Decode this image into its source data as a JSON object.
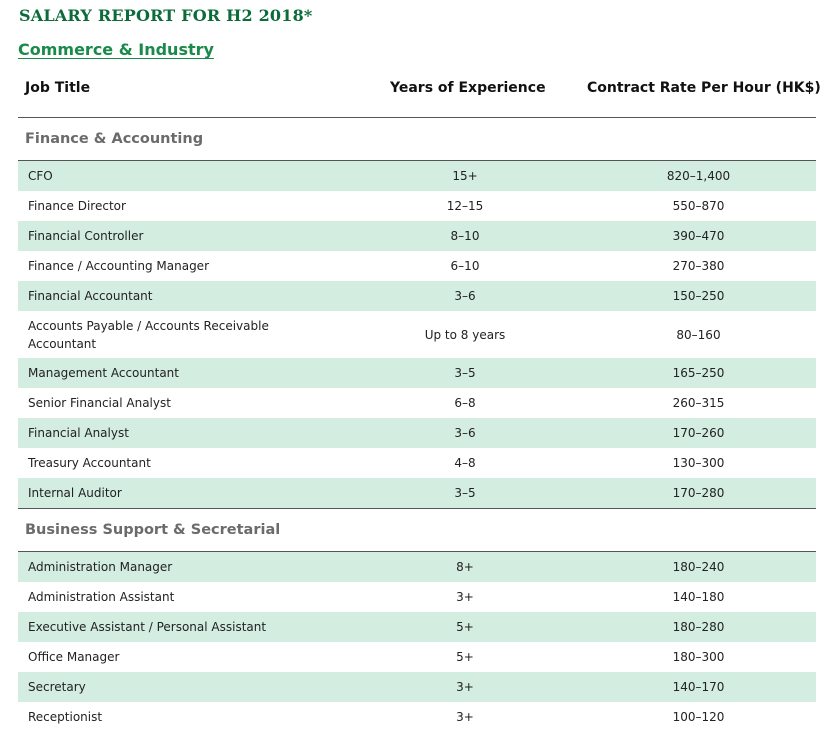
{
  "report": {
    "title": "SALARY REPORT FOR H2 2018*",
    "section": "Commerce & Industry"
  },
  "columns": {
    "job_title": "Job Title",
    "experience": "Years of Experience",
    "rate": "Contract Rate Per Hour (HK$)"
  },
  "groups": [
    {
      "name": "Finance & Accounting",
      "rows": [
        {
          "title": "CFO",
          "experience": "15+",
          "rate": "820–1,400"
        },
        {
          "title": "Finance Director",
          "experience": "12–15",
          "rate": "550–870"
        },
        {
          "title": "Financial Controller",
          "experience": "8–10",
          "rate": "390–470"
        },
        {
          "title": "Finance / Accounting Manager",
          "experience": "6–10",
          "rate": "270–380"
        },
        {
          "title": "Financial Accountant",
          "experience": "3–6",
          "rate": "150–250"
        },
        {
          "title": "Accounts Payable / Accounts Receivable Accountant",
          "experience": "Up to 8 years",
          "rate": "80–160"
        },
        {
          "title": "Management Accountant",
          "experience": "3–5",
          "rate": "165–250"
        },
        {
          "title": "Senior Financial Analyst",
          "experience": "6–8",
          "rate": "260–315"
        },
        {
          "title": "Financial Analyst",
          "experience": "3–6",
          "rate": "170–260"
        },
        {
          "title": "Treasury Accountant",
          "experience": "4–8",
          "rate": "130–300"
        },
        {
          "title": "Internal Auditor",
          "experience": "3–5",
          "rate": "170–280"
        }
      ]
    },
    {
      "name": "Business Support & Secretarial",
      "rows": [
        {
          "title": "Administration Manager",
          "experience": "8+",
          "rate": "180–240"
        },
        {
          "title": "Administration Assistant",
          "experience": "3+",
          "rate": "140–180"
        },
        {
          "title": "Executive Assistant / Personal Assistant",
          "experience": "5+",
          "rate": "180–280"
        },
        {
          "title": "Office Manager",
          "experience": "5+",
          "rate": "180–300"
        },
        {
          "title": "Secretary",
          "experience": "3+",
          "rate": "140–170"
        },
        {
          "title": "Receptionist",
          "experience": "3+",
          "rate": "100–120"
        }
      ]
    }
  ],
  "colors": {
    "title_green": "#0c6b3a",
    "link_green": "#1a8a4a",
    "row_shade": "#d3ede1",
    "group_text": "#6b6b6b"
  }
}
